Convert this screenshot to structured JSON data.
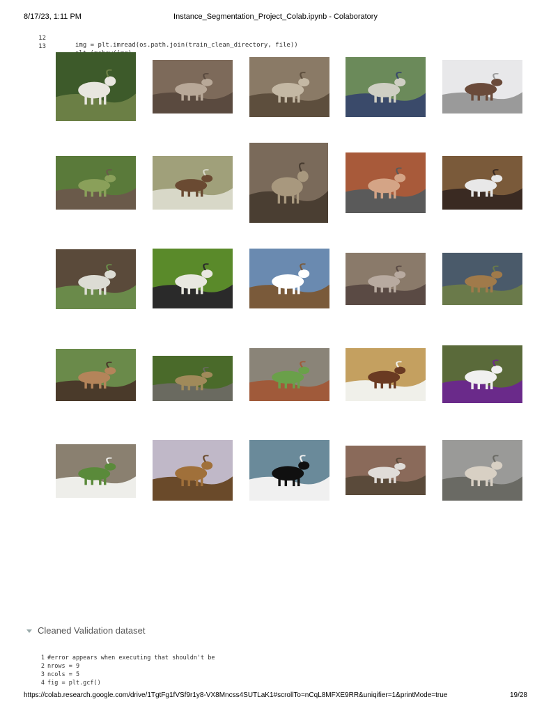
{
  "header": {
    "datetime": "8/17/23, 1:11 PM",
    "title": "Instance_Segmentation_Project_Colab.ipynb - Colaboratory"
  },
  "code_cell": {
    "lines": [
      {
        "num": "12",
        "code": "img = plt.imread(os.path.join(train_clean_directory, file))"
      },
      {
        "num": "13",
        "code": "plt.imshow(img)"
      }
    ]
  },
  "output_images": [
    {
      "name": "goat-image-1",
      "colors": [
        "#3d5a2a",
        "#e8e6df",
        "#6b7f45"
      ]
    },
    {
      "name": "goat-image-2",
      "colors": [
        "#7d6a5a",
        "#b8a898",
        "#5a4a3f"
      ]
    },
    {
      "name": "goat-image-3",
      "colors": [
        "#8a7a66",
        "#c4b8a4",
        "#5d4e3d"
      ]
    },
    {
      "name": "goat-image-4",
      "colors": [
        "#6b8a5a",
        "#cfcfc4",
        "#3a4a6a"
      ]
    },
    {
      "name": "goat-image-5",
      "colors": [
        "#e8e8ea",
        "#6a4a3a",
        "#9a9a9a"
      ]
    },
    {
      "name": "goat-image-6",
      "colors": [
        "#5a7a3a",
        "#8aa05a",
        "#6a5a4a"
      ]
    },
    {
      "name": "goat-image-7",
      "colors": [
        "#a0a07a",
        "#6a4a32",
        "#d8d8c8"
      ]
    },
    {
      "name": "goat-image-8",
      "colors": [
        "#7a6a5a",
        "#a8987e",
        "#4a3e32"
      ]
    },
    {
      "name": "goat-image-9",
      "colors": [
        "#a85a3a",
        "#d4a486",
        "#5a5a5a"
      ]
    },
    {
      "name": "goat-image-10",
      "colors": [
        "#7a5a3a",
        "#e8e8e8",
        "#3a2a22"
      ]
    },
    {
      "name": "goat-image-11",
      "colors": [
        "#5a4a3a",
        "#dcdcd4",
        "#6a8a4a"
      ]
    },
    {
      "name": "goat-image-12",
      "colors": [
        "#5a8a2a",
        "#e8e8e0",
        "#2a2a2a"
      ]
    },
    {
      "name": "goat-image-13",
      "colors": [
        "#6a8ab0",
        "#ffffff",
        "#7a5a3a"
      ]
    },
    {
      "name": "goat-image-14",
      "colors": [
        "#8a7a6a",
        "#b8aaa0",
        "#5a4a44"
      ]
    },
    {
      "name": "goat-image-15",
      "colors": [
        "#4a5a6a",
        "#a07a4a",
        "#6a7a4a"
      ]
    },
    {
      "name": "goat-image-16",
      "colors": [
        "#6a8a4a",
        "#b4845a",
        "#4a3a2a"
      ]
    },
    {
      "name": "goat-image-17",
      "colors": [
        "#4a6a2a",
        "#a08a5a",
        "#6a6a60"
      ]
    },
    {
      "name": "goat-image-18",
      "colors": [
        "#8a8478",
        "#6aa04a",
        "#a05a3a"
      ]
    },
    {
      "name": "goat-image-19",
      "colors": [
        "#c4a060",
        "#6a3a22",
        "#f0f0ea"
      ]
    },
    {
      "name": "goat-image-20",
      "colors": [
        "#5a6a3a",
        "#f0f0f0",
        "#6a2a8a"
      ]
    },
    {
      "name": "goat-image-21",
      "colors": [
        "#8a8070",
        "#5a8a3a",
        "#eeeeea"
      ]
    },
    {
      "name": "goat-image-22",
      "colors": [
        "#c0b8c8",
        "#a0703a",
        "#6a4a2a"
      ]
    },
    {
      "name": "goat-image-23",
      "colors": [
        "#6a8a9a",
        "#101010",
        "#f0f0f0"
      ]
    },
    {
      "name": "goat-image-24",
      "colors": [
        "#8a6a5a",
        "#e0dcd8",
        "#5a4a3a"
      ]
    },
    {
      "name": "goat-image-25",
      "colors": [
        "#9a9a98",
        "#d8d0c4",
        "#6a6a64"
      ]
    }
  ],
  "section": {
    "title": "Cleaned Validation dataset"
  },
  "code_cell_2": {
    "lines": [
      {
        "num": "1",
        "code": "#error appears when executing that shouldn't be"
      },
      {
        "num": "2",
        "code": "nrows = 9"
      },
      {
        "num": "3",
        "code": "ncols = 5"
      },
      {
        "num": "4",
        "code": "fig = plt.gcf()"
      }
    ]
  },
  "footer": {
    "url": "https://colab.research.google.com/drive/1TgtFg1fVSf9r1y8-VX8Mncss4SUTLaK1#scrollTo=nCqL8MFXE9RR&uniqifier=1&printMode=true",
    "page": "19/28"
  }
}
